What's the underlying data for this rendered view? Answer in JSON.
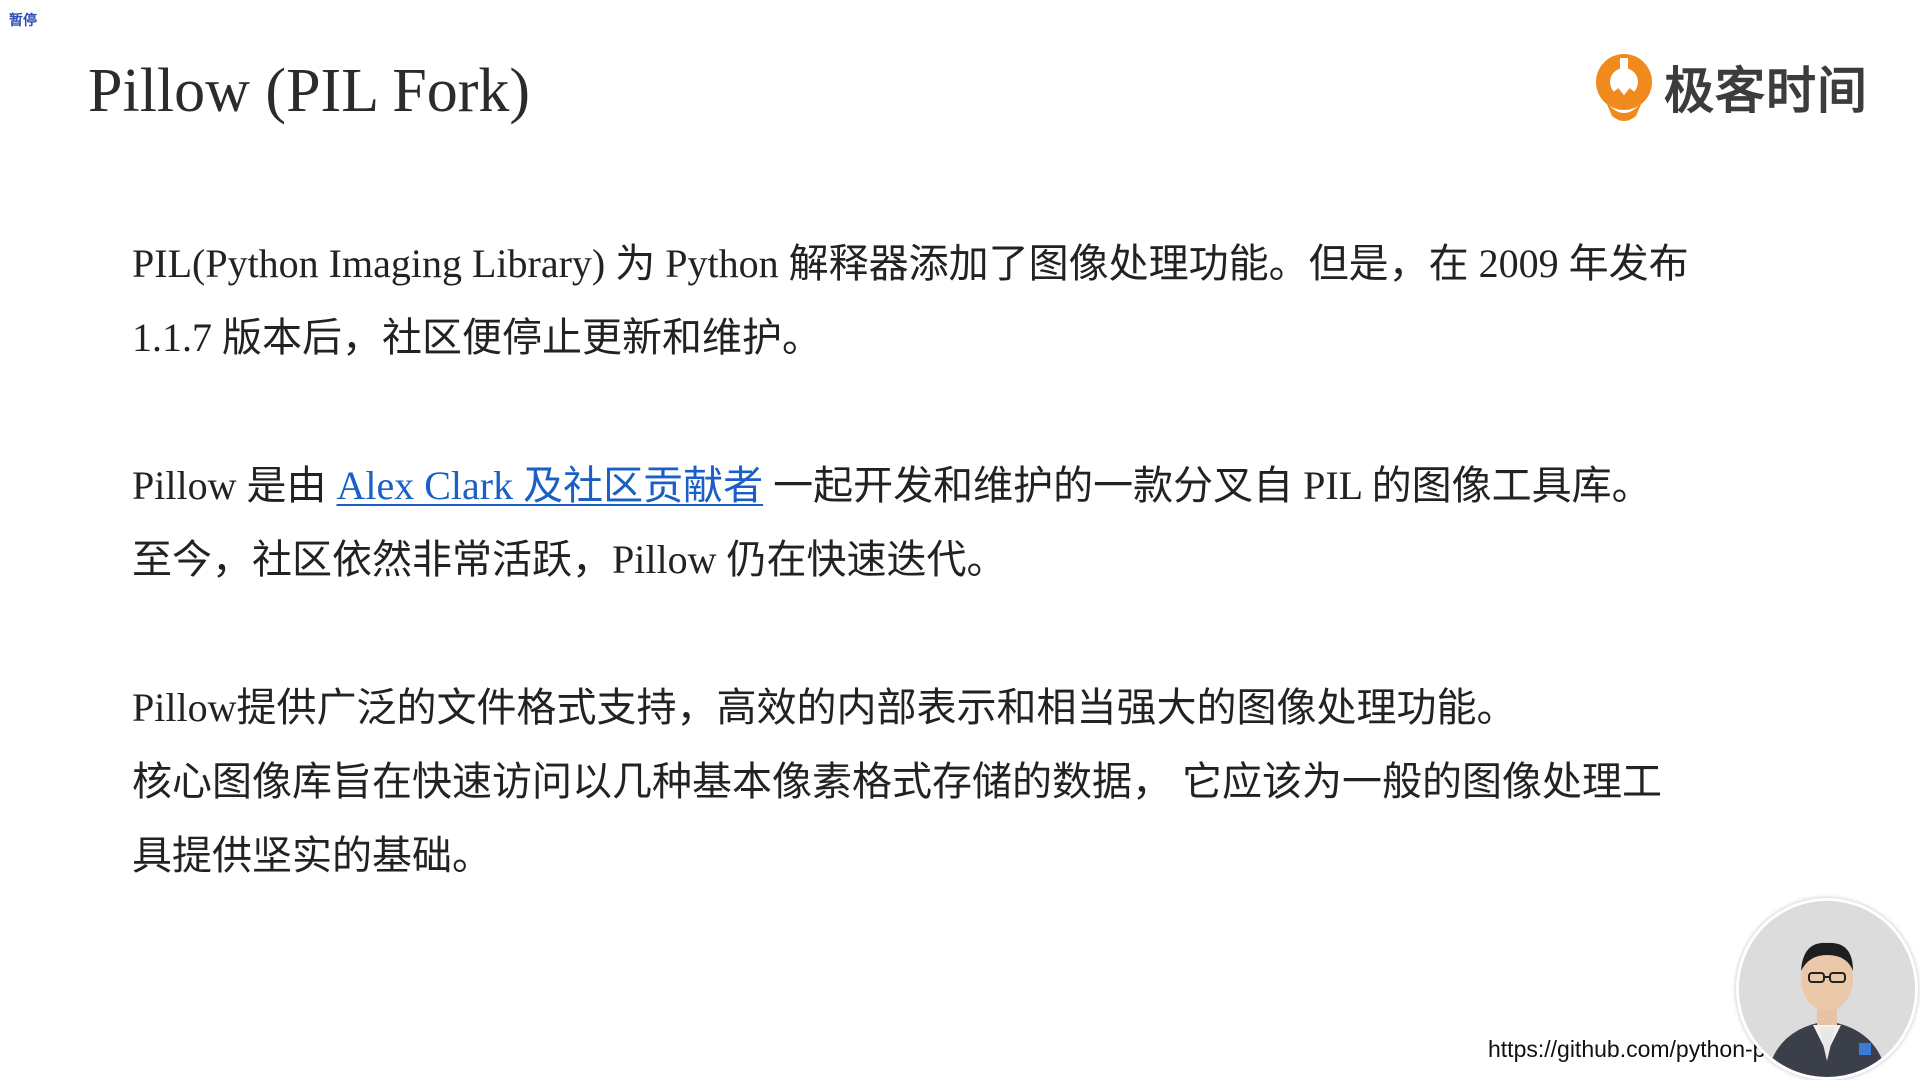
{
  "overlay": {
    "pause_tag": "暂停"
  },
  "slide": {
    "title": "Pillow (PIL Fork)",
    "logo_text": "极客时间",
    "paragraphs": {
      "p1": {
        "line1": "PIL(Python Imaging Library) 为 Python 解释器添加了图像处理功能。但是，在 2009 年发布",
        "line2": "1.1.7 版本后，社区便停止更新和维护。"
      },
      "p2": {
        "line1_prefix": "Pillow 是由 ",
        "line1_link": "Alex Clark 及社区贡献者",
        "line1_suffix": " 一起开发和维护的一款分叉自 PIL 的图像工具库。",
        "line2": "至今，社区依然非常活跃，Pillow 仍在快速迭代。"
      },
      "p3": {
        "line1": "Pillow提供广泛的文件格式支持，高效的内部表示和相当强大的图像处理功能。",
        "line2": "核心图像库旨在快速访问以几种基本像素格式存储的数据， 它应该为一般的图像处理工",
        "line3": "具提供坚实的基础。"
      }
    },
    "url_caption": "https://github.com/python-pillow/Pillow"
  },
  "colors": {
    "link": "#1a5fc7",
    "logo_orange": "#f08a1c",
    "pause_tag": "#2f4fb5"
  },
  "icons": {
    "logo": "geektime-logo-icon",
    "presenter": "presenter-video-avatar"
  }
}
